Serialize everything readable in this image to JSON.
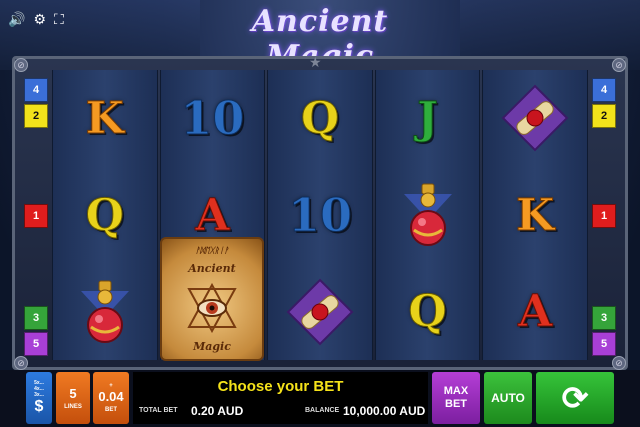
{
  "top_bar": {
    "sound_icon": "🔊",
    "settings_icon": "⚙",
    "fullscreen_icon": "⛶"
  },
  "logo": "Ancient Magic",
  "frame": {
    "corner_symbol": "⊘",
    "star": "★"
  },
  "paylines_left": [
    {
      "num": "4",
      "color": "#3b6fd8",
      "row": 0
    },
    {
      "num": "2",
      "color": "#f2e21b",
      "row": 1
    },
    {
      "num": "1",
      "color": "#e01d1d",
      "row": 3
    },
    {
      "num": "3",
      "color": "#35a43a",
      "row": 5
    },
    {
      "num": "5",
      "color": "#a83fd6",
      "row": 6
    }
  ],
  "paylines_right": [
    {
      "num": "4",
      "color": "#3b6fd8",
      "row": 0
    },
    {
      "num": "2",
      "color": "#f2e21b",
      "row": 1
    },
    {
      "num": "1",
      "color": "#e01d1d",
      "row": 3
    },
    {
      "num": "3",
      "color": "#35a43a",
      "row": 5
    },
    {
      "num": "5",
      "color": "#a83fd6",
      "row": 6
    }
  ],
  "reels": [
    [
      "K",
      "Q",
      "potion"
    ],
    [
      "10",
      "A",
      "book"
    ],
    [
      "Q",
      "10",
      "scroll"
    ],
    [
      "J",
      "potion",
      "Q"
    ],
    [
      "scroll",
      "K",
      "A"
    ]
  ],
  "book": {
    "top_text": "Ancient",
    "bottom_text": "Magic",
    "rune_text": "ᚨᛞᛖᚷᚱᛁᚨ"
  },
  "controls": {
    "paytable_label": "5x... 4x... 3x...",
    "paytable_icon": "$",
    "lines_value": "5",
    "lines_label": "LINES",
    "bet_value": "0.04",
    "bet_label": "BET",
    "bet_up": "+",
    "bet_down": "−",
    "message": "Choose your BET",
    "total_bet_label": "TOTAL BET",
    "total_bet_value": "0.20 AUD",
    "balance_label": "BALANCE",
    "balance_value": "10,000.00 AUD",
    "max_bet_label": "MAX BET",
    "auto_label": "AUTO",
    "spin_icon": "⟳"
  }
}
